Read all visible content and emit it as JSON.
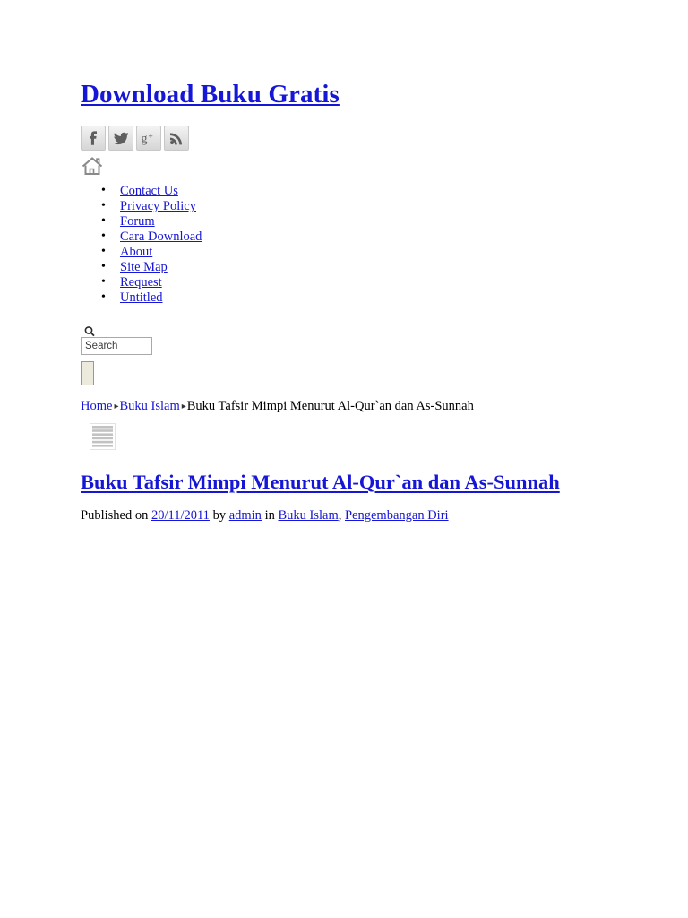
{
  "site": {
    "title": "Download Buku Gratis"
  },
  "social": {
    "items": [
      {
        "name": "facebook",
        "icon": "facebook-icon",
        "label": "f"
      },
      {
        "name": "twitter",
        "icon": "twitter-icon",
        "label": "t"
      },
      {
        "name": "googleplus",
        "icon": "google-plus-icon",
        "label": "g+"
      },
      {
        "name": "rss",
        "icon": "rss-icon",
        "label": "rss"
      }
    ]
  },
  "home": {
    "icon": "home-icon"
  },
  "nav": {
    "items": [
      {
        "label": "Contact Us"
      },
      {
        "label": "Privacy Policy"
      },
      {
        "label": "Forum"
      },
      {
        "label": "Cara Download"
      },
      {
        "label": "About"
      },
      {
        "label": "Site Map"
      },
      {
        "label": "Request"
      },
      {
        "label": "Untitled"
      }
    ]
  },
  "search": {
    "icon": "search-icon",
    "value": "Search",
    "placeholder": "Search",
    "submit_label": ""
  },
  "breadcrumb": {
    "separator": "▸",
    "items": [
      {
        "label": "Home",
        "link": true
      },
      {
        "label": "Buku Islam",
        "link": true
      },
      {
        "label": "Buku Tafsir Mimpi Menurut Al-Qur`an dan As-Sunnah",
        "link": false
      }
    ]
  },
  "article_icon": {
    "icon": "article-lines-icon"
  },
  "post": {
    "title": "Buku Tafsir Mimpi Menurut Al-Qur`an dan As-Sunnah",
    "meta": {
      "published_prefix": "Published on",
      "date": "20/11/2011",
      "by_text": "by",
      "author": "admin",
      "in_text": "in",
      "categories": [
        {
          "label": "Buku Islam"
        },
        {
          "label": "Pengembangan Diri"
        }
      ],
      "category_separator": ", "
    }
  },
  "colors": {
    "link": "#1616d6",
    "text": "#000000",
    "background": "#ffffff",
    "icon_gray": "#6b6b6b",
    "button_beige": "#eceadd"
  }
}
